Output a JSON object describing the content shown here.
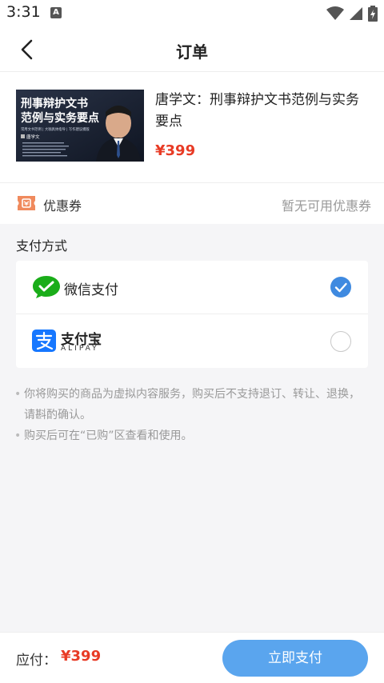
{
  "status_bar": {
    "time": "3:31",
    "notification_letter": "A"
  },
  "nav": {
    "title": "订单"
  },
  "product": {
    "title": "唐学文：刑事辩护文书范例与实务要点",
    "price": "¥399",
    "thumbnail": {
      "headline_line1": "刑事辩护文书",
      "headline_line2": "范例与实务要点",
      "subtitle": "常用文书范例 | 大咖具体指导 | 写作建议模版",
      "author": "唐学文"
    }
  },
  "coupon": {
    "label": "优惠券",
    "value": "暂无可用优惠券",
    "icon": "coupon-icon"
  },
  "payment": {
    "section_title": "支付方式",
    "options": [
      {
        "name": "微信支付",
        "icon": "wechat-icon",
        "selected": true
      },
      {
        "name": "支付宝",
        "sub": "ALIPAY",
        "icon": "alipay-icon",
        "selected": false
      }
    ]
  },
  "notes": [
    "你将购买的商品为虚拟内容服务，购买后不支持退订、转让、退换，请斟酌确认。",
    "购买后可在“已购”区查看和使用。"
  ],
  "footer": {
    "label": "应付：",
    "price": "¥399",
    "pay_button": "立即支付"
  },
  "colors": {
    "price_red": "#e83b25",
    "button_blue": "#5aa5ee",
    "check_blue": "#3f8ae0",
    "wechat_green": "#1aad19",
    "alipay_blue": "#1677ff"
  }
}
